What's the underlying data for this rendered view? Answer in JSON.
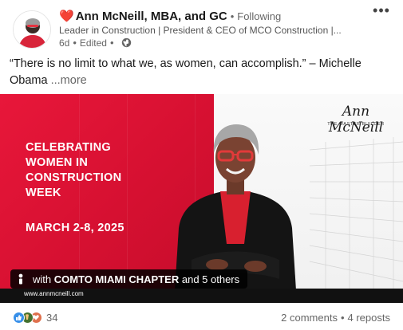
{
  "post": {
    "author": {
      "name": "Ann McNeill, MBA, and GC",
      "emoji": "❤️",
      "connection_status": "Following",
      "headline": "Leader in Construction | President & CEO of MCO Construction |...",
      "time_ago": "6d",
      "edited_label": "Edited",
      "visibility_icon": "globe-icon"
    },
    "menu_icon": "more-icon",
    "caption": {
      "text": "“There is no limit to what we, as women, can accomplish.” – Michelle Obama",
      "more_label": "...more"
    },
    "image": {
      "headline_lines": [
        "CELEBRATING",
        "WOMEN IN",
        "CONSTRUCTION",
        "WEEK"
      ],
      "dates": "MARCH 2-8, 2025",
      "brand_name": "Ann McNeill",
      "brand_tagline": "THE MASTER BUILDER",
      "website": "www.annmcneill.com",
      "tag": {
        "prefix": "with",
        "organization": "COMTO MIAMI CHAPTER",
        "suffix": "and 5 others"
      }
    },
    "social": {
      "reaction_icons": [
        "like-icon",
        "celebrate-icon",
        "love-icon"
      ],
      "reaction_count": "34",
      "comments": "2 comments",
      "reposts": "4 reposts"
    }
  },
  "colors": {
    "brand_red": "#d61031",
    "like_blue": "#378fe9",
    "celebrate_green": "#44712e",
    "love_red": "#df704d"
  }
}
